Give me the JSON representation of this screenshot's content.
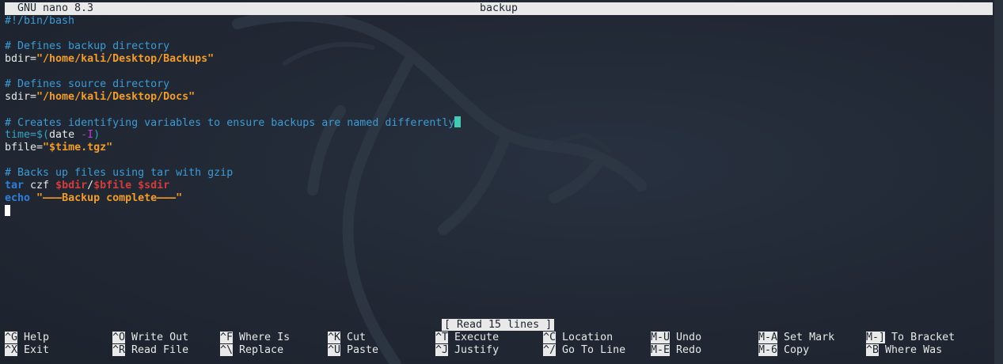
{
  "titlebar": {
    "app": "GNU nano 8.3",
    "filename": "backup"
  },
  "code": {
    "l1": "#!/bin/bash",
    "l3": "# Defines backup directory",
    "l4_a": "bdir=",
    "l4_b": "\"/home/kali/Desktop/Backups\"",
    "l6": "# Defines source directory",
    "l7_a": "sdir=",
    "l7_b": "\"/home/kali/Desktop/Docs\"",
    "l9": "# Creates identifying variables to ensure backups are named differently",
    "l10_a": "time=$(",
    "l10_b": "date ",
    "l10_c": "-I",
    "l10_d": ")",
    "l11_a": "bfile=",
    "l11_b": "\"$time.tgz\"",
    "l13": "# Backs up files using tar with gzip",
    "l14_a": "tar",
    "l14_b": " czf ",
    "l14_c": "$bdir",
    "l14_d": "/",
    "l14_e": "$bfile",
    "l14_f": " ",
    "l14_g": "$sdir",
    "l15_a": "echo",
    "l15_b": " ",
    "l15_c": "\"———Backup complete———\""
  },
  "status": {
    "message": "[ Read 15 lines ]"
  },
  "shortcuts": [
    {
      "key": "^G",
      "label": "Help"
    },
    {
      "key": "^X",
      "label": "Exit"
    },
    {
      "key": "^O",
      "label": "Write Out"
    },
    {
      "key": "^R",
      "label": "Read File"
    },
    {
      "key": "^F",
      "label": "Where Is"
    },
    {
      "key": "^\\",
      "label": "Replace"
    },
    {
      "key": "^K",
      "label": "Cut"
    },
    {
      "key": "^U",
      "label": "Paste"
    },
    {
      "key": "^T",
      "label": "Execute"
    },
    {
      "key": "^J",
      "label": "Justify"
    },
    {
      "key": "^C",
      "label": "Location"
    },
    {
      "key": "^/",
      "label": "Go To Line"
    },
    {
      "key": "M-U",
      "label": "Undo"
    },
    {
      "key": "M-E",
      "label": "Redo"
    },
    {
      "key": "M-A",
      "label": "Set Mark"
    },
    {
      "key": "M-6",
      "label": "Copy"
    },
    {
      "key": "M-]",
      "label": "To Bracket"
    },
    {
      "key": "^B",
      "label": "Where Was"
    }
  ],
  "colors": {
    "background": "#222a35",
    "comment": "#3c9bd6",
    "string": "#f39c27",
    "keyword": "#2e7fdc",
    "variable": "#d23c3c",
    "option": "#b23bd1",
    "cursor": "#45c8b4",
    "bar": "#e9e9e9"
  }
}
